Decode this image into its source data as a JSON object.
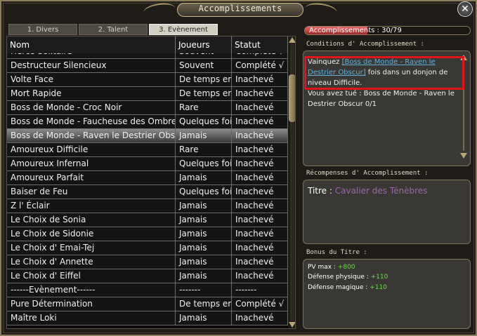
{
  "window": {
    "title": "Accomplissements"
  },
  "tabs": [
    {
      "label": "1. Divers",
      "active": false
    },
    {
      "label": "2. Talent",
      "active": false
    },
    {
      "label": "3. Evènement",
      "active": true
    }
  ],
  "table": {
    "headers": {
      "name": "Nom",
      "players": "Joueurs",
      "status": "Statut"
    },
    "partial_top": {
      "name": "Héros Solitaire",
      "players": "Souvent",
      "status": "Complété √"
    },
    "rows": [
      {
        "name": "Destructeur Silencieux",
        "players": "Souvent",
        "status": "Complété √",
        "selected": false
      },
      {
        "name": "Volte Face",
        "players": "De temps en temps",
        "status": "Inachevé",
        "selected": false
      },
      {
        "name": "Mort Rapide",
        "players": "De temps en temps",
        "status": "Inachevé",
        "selected": false
      },
      {
        "name": "Boss de Monde - Croc Noir",
        "players": "Rare",
        "status": "Inachevé",
        "selected": false
      },
      {
        "name": "Boss de Monde - Faucheuse des Ombres",
        "players": "Quelques fois",
        "status": "Inachevé",
        "selected": false
      },
      {
        "name": "Boss de Monde - Raven le Destrier Obscur",
        "players": "Jamais",
        "status": "Inachevé",
        "selected": true
      },
      {
        "name": "Amoureux Difficile",
        "players": "Rare",
        "status": "Inachevé",
        "selected": false
      },
      {
        "name": "Amoureux Infernal",
        "players": "Quelques fois",
        "status": "Inachevé",
        "selected": false
      },
      {
        "name": "Amoureux Parfait",
        "players": "Jamais",
        "status": "Inachevé",
        "selected": false
      },
      {
        "name": "Baiser de Feu",
        "players": "Quelques fois",
        "status": "Inachevé",
        "selected": false
      },
      {
        "name": "Z l' Éclair",
        "players": "Jamais",
        "status": "Inachevé",
        "selected": false
      },
      {
        "name": "Le Choix de Sonia",
        "players": "Jamais",
        "status": "Inachevé",
        "selected": false
      },
      {
        "name": "Le Choix de Sidonie",
        "players": "Jamais",
        "status": "Inachevé",
        "selected": false
      },
      {
        "name": "Le Choix d' Emai-Tej",
        "players": "Jamais",
        "status": "Inachevé",
        "selected": false
      },
      {
        "name": "Le Choix d' Annette",
        "players": "Jamais",
        "status": "Inachevé",
        "selected": false
      },
      {
        "name": "Le Choix d' Eiffel",
        "players": "Jamais",
        "status": "Inachevé",
        "selected": false
      },
      {
        "name": "------Evènement------",
        "players": "-------",
        "status": "-------",
        "selected": false
      },
      {
        "name": "Pure Détermination",
        "players": "De temps en temps",
        "status": "Complété √",
        "selected": false
      },
      {
        "name": "Maître Loki",
        "players": "Jamais",
        "status": "Inachevé",
        "selected": false
      }
    ]
  },
  "progress": {
    "label": "Accomplissements : 30/79",
    "current": 30,
    "total": 79
  },
  "conditions": {
    "heading": "Conditions d' Accomplissement :",
    "prefix": "Vainquez ",
    "link": "[Boss de Monde - Raven le Destrier Obscur]",
    "suffix": " fois dans un donjon de niveau Difficile.",
    "killed": "Vous avez tué : Boss de Monde - Raven le Destrier Obscur 0/1"
  },
  "rewards": {
    "heading": "Récompenses d' Accomplissement :",
    "label": "Titre : ",
    "value": "Cavalier des Ténèbres"
  },
  "bonus": {
    "heading": "Bonus du Titre :",
    "items": [
      {
        "label": "PV max : ",
        "value": "+800"
      },
      {
        "label": "Défense physique : ",
        "value": "+110"
      },
      {
        "label": "Défense magique : ",
        "value": "+110"
      }
    ]
  },
  "colors": {
    "accent_frame": "#8c7c5a",
    "progress_fill": "#e8686a",
    "link": "#5fb0d8",
    "reward_title": "#9a6aa8",
    "bonus_value": "#6ad84a",
    "highlight_box": "#e0151b"
  }
}
